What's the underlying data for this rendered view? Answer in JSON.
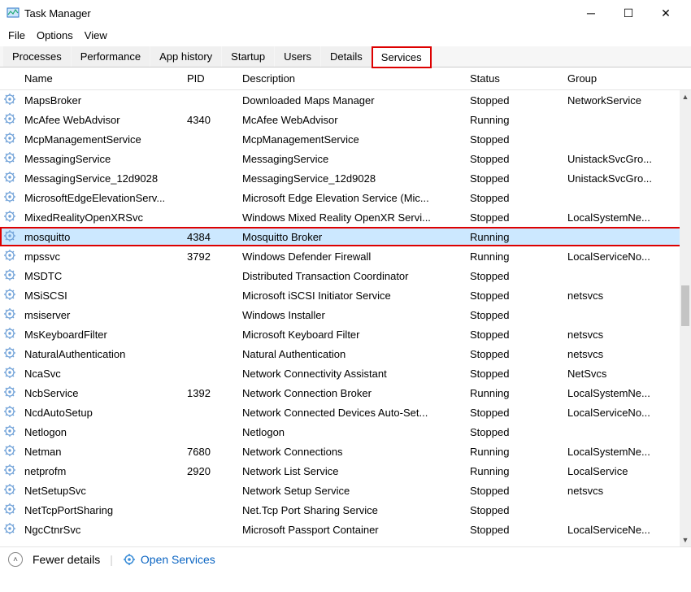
{
  "window": {
    "title": "Task Manager"
  },
  "menu": {
    "file": "File",
    "options": "Options",
    "view": "View"
  },
  "tabs": {
    "processes": "Processes",
    "performance": "Performance",
    "apphistory": "App history",
    "startup": "Startup",
    "users": "Users",
    "details": "Details",
    "services": "Services"
  },
  "columns": {
    "name": "Name",
    "pid": "PID",
    "description": "Description",
    "status": "Status",
    "group": "Group"
  },
  "services": [
    {
      "name": "MapsBroker",
      "pid": "",
      "desc": "Downloaded Maps Manager",
      "status": "Stopped",
      "group": "NetworkService"
    },
    {
      "name": "McAfee WebAdvisor",
      "pid": "4340",
      "desc": "McAfee WebAdvisor",
      "status": "Running",
      "group": ""
    },
    {
      "name": "McpManagementService",
      "pid": "",
      "desc": "McpManagementService",
      "status": "Stopped",
      "group": ""
    },
    {
      "name": "MessagingService",
      "pid": "",
      "desc": "MessagingService",
      "status": "Stopped",
      "group": "UnistackSvcGro..."
    },
    {
      "name": "MessagingService_12d9028",
      "pid": "",
      "desc": "MessagingService_12d9028",
      "status": "Stopped",
      "group": "UnistackSvcGro..."
    },
    {
      "name": "MicrosoftEdgeElevationServ...",
      "pid": "",
      "desc": "Microsoft Edge Elevation Service (Mic...",
      "status": "Stopped",
      "group": ""
    },
    {
      "name": "MixedRealityOpenXRSvc",
      "pid": "",
      "desc": "Windows Mixed Reality OpenXR Servi...",
      "status": "Stopped",
      "group": "LocalSystemNe..."
    },
    {
      "name": "mosquitto",
      "pid": "4384",
      "desc": "Mosquitto Broker",
      "status": "Running",
      "group": "",
      "selected": true,
      "hl": true
    },
    {
      "name": "mpssvc",
      "pid": "3792",
      "desc": "Windows Defender Firewall",
      "status": "Running",
      "group": "LocalServiceNo..."
    },
    {
      "name": "MSDTC",
      "pid": "",
      "desc": "Distributed Transaction Coordinator",
      "status": "Stopped",
      "group": ""
    },
    {
      "name": "MSiSCSI",
      "pid": "",
      "desc": "Microsoft iSCSI Initiator Service",
      "status": "Stopped",
      "group": "netsvcs"
    },
    {
      "name": "msiserver",
      "pid": "",
      "desc": "Windows Installer",
      "status": "Stopped",
      "group": ""
    },
    {
      "name": "MsKeyboardFilter",
      "pid": "",
      "desc": "Microsoft Keyboard Filter",
      "status": "Stopped",
      "group": "netsvcs"
    },
    {
      "name": "NaturalAuthentication",
      "pid": "",
      "desc": "Natural Authentication",
      "status": "Stopped",
      "group": "netsvcs"
    },
    {
      "name": "NcaSvc",
      "pid": "",
      "desc": "Network Connectivity Assistant",
      "status": "Stopped",
      "group": "NetSvcs"
    },
    {
      "name": "NcbService",
      "pid": "1392",
      "desc": "Network Connection Broker",
      "status": "Running",
      "group": "LocalSystemNe..."
    },
    {
      "name": "NcdAutoSetup",
      "pid": "",
      "desc": "Network Connected Devices Auto-Set...",
      "status": "Stopped",
      "group": "LocalServiceNo..."
    },
    {
      "name": "Netlogon",
      "pid": "",
      "desc": "Netlogon",
      "status": "Stopped",
      "group": ""
    },
    {
      "name": "Netman",
      "pid": "7680",
      "desc": "Network Connections",
      "status": "Running",
      "group": "LocalSystemNe..."
    },
    {
      "name": "netprofm",
      "pid": "2920",
      "desc": "Network List Service",
      "status": "Running",
      "group": "LocalService"
    },
    {
      "name": "NetSetupSvc",
      "pid": "",
      "desc": "Network Setup Service",
      "status": "Stopped",
      "group": "netsvcs"
    },
    {
      "name": "NetTcpPortSharing",
      "pid": "",
      "desc": "Net.Tcp Port Sharing Service",
      "status": "Stopped",
      "group": ""
    },
    {
      "name": "NgcCtnrSvc",
      "pid": "",
      "desc": "Microsoft Passport Container",
      "status": "Stopped",
      "group": "LocalServiceNe..."
    }
  ],
  "footer": {
    "fewer": "Fewer details",
    "open": "Open Services"
  }
}
